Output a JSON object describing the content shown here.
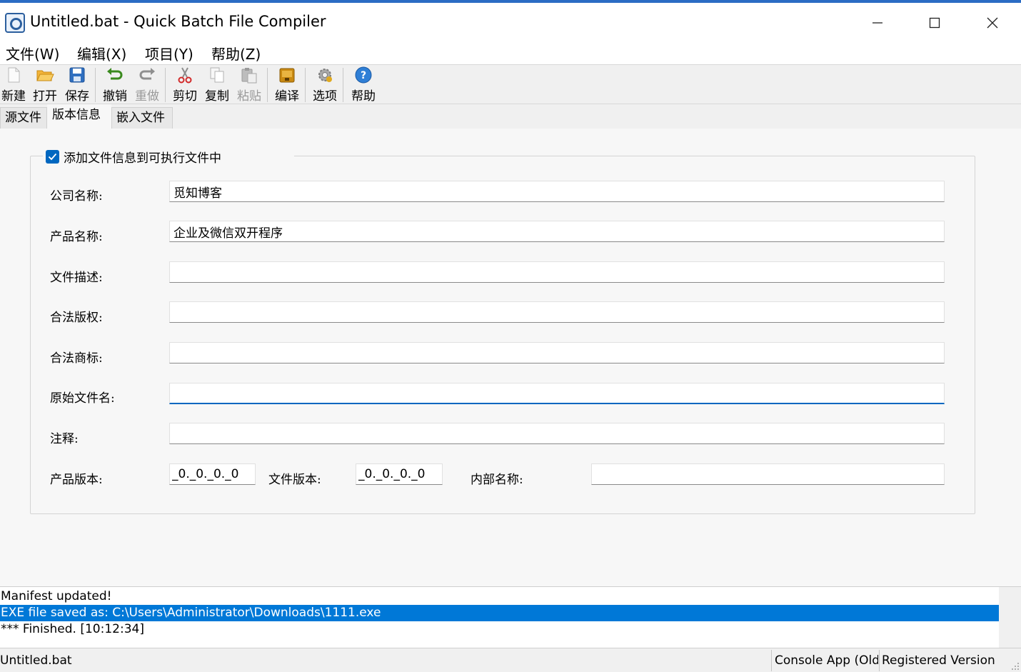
{
  "window": {
    "title": "Untitled.bat - Quick Batch File Compiler",
    "minimize_icon": "minimize-icon",
    "maximize_icon": "maximize-icon",
    "close_icon": "close-icon"
  },
  "menu": [
    "文件(W)",
    "编辑(X)",
    "项目(Y)",
    "帮助(Z)"
  ],
  "toolbar": {
    "new": "新建",
    "open": "打开",
    "save": "保存",
    "undo": "撤销",
    "redo": "重做",
    "cut": "剪切",
    "copy": "复制",
    "paste": "粘贴",
    "compile": "编译",
    "options": "选项",
    "help": "帮助"
  },
  "tabs": [
    "源文件",
    "版本信息",
    "嵌入文件"
  ],
  "version_info": {
    "add_info_checkbox": {
      "label": "添加文件信息到可执行文件中",
      "checked": true
    },
    "fields": {
      "company": {
        "label": "公司名称:",
        "value": "觅知博客"
      },
      "product": {
        "label": "产品名称:",
        "value": "企业及微信双开程序"
      },
      "description": {
        "label": "文件描述:",
        "value": ""
      },
      "copyright": {
        "label": "合法版权:",
        "value": ""
      },
      "trademark": {
        "label": "合法商标:",
        "value": ""
      },
      "original_filename": {
        "label": "原始文件名:",
        "value": ""
      },
      "comments": {
        "label": "注释:",
        "value": ""
      }
    },
    "product_version": {
      "label": "产品版本:",
      "value": "_0._0._0._0"
    },
    "file_version": {
      "label": "文件版本:",
      "value": "_0._0._0._0"
    },
    "internal_name": {
      "label": "内部名称:",
      "value": ""
    }
  },
  "log": [
    "Manifest updated!",
    "EXE file saved as: C:\\Users\\Administrator\\Downloads\\1111.exe",
    "*** Finished. [10:12:34]"
  ],
  "status": {
    "file": "Untitled.bat",
    "app_type": "Console App (Old",
    "registration": "Registered Version"
  },
  "colors": {
    "accent": "#0067c0",
    "selection": "#0078d7"
  }
}
